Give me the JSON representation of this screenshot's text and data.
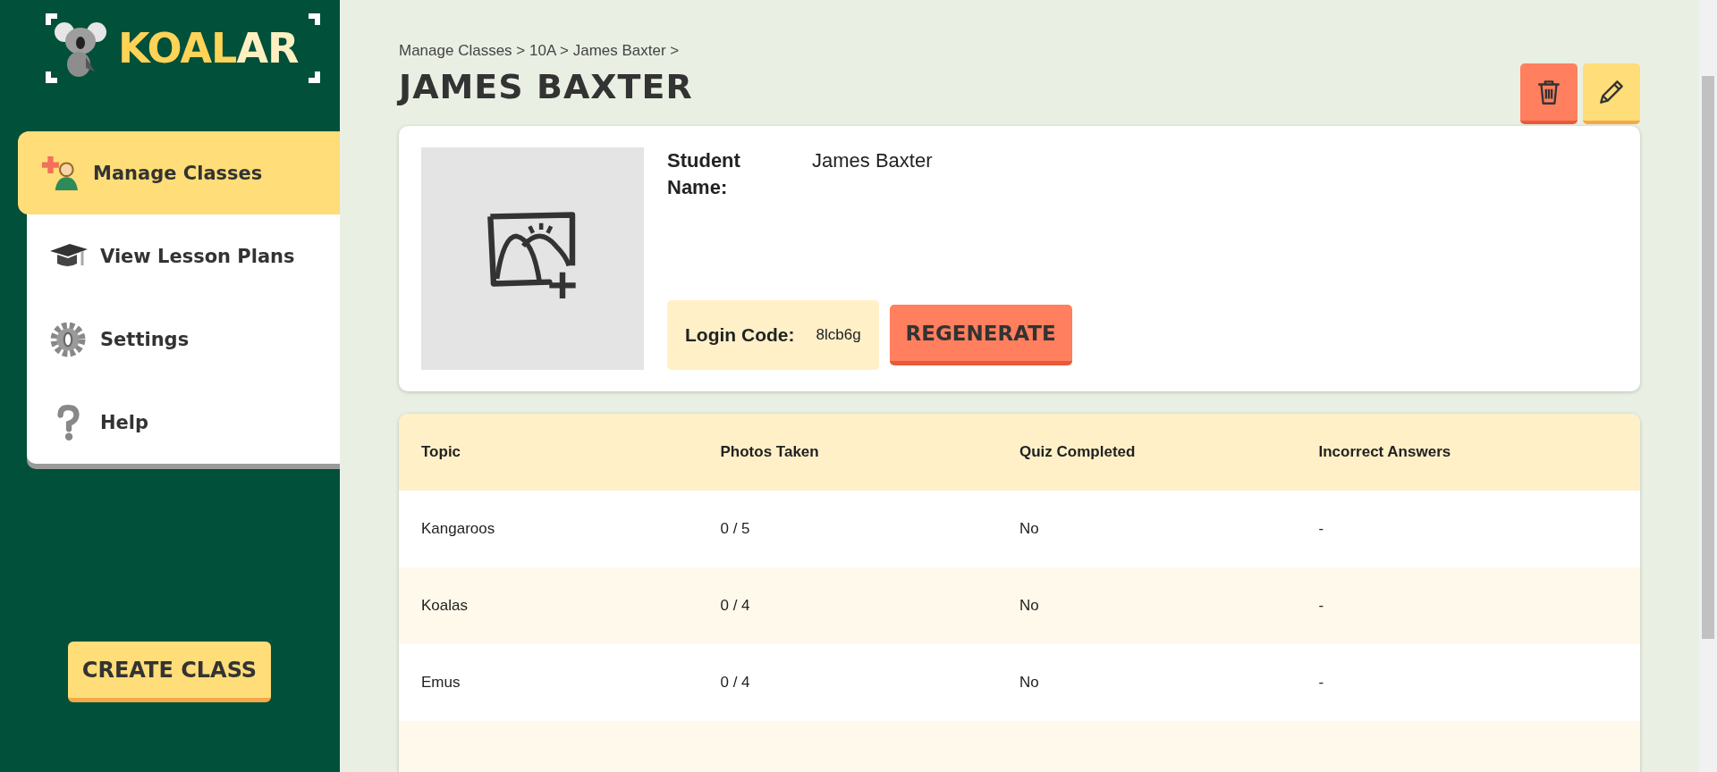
{
  "logo": {
    "text_main": "KOAL",
    "text_accent": "AR"
  },
  "sidebar": {
    "items": [
      {
        "label": "Manage Classes",
        "kind": "classes",
        "selected": true
      },
      {
        "label": "View Lesson Plans",
        "kind": "lessons",
        "selected": false
      },
      {
        "label": "Settings",
        "kind": "settings",
        "selected": false
      },
      {
        "label": "Help",
        "kind": "help",
        "selected": false
      }
    ],
    "create_button": "CREATE CLASS"
  },
  "breadcrumb": "Manage Classes > 10A > James Baxter >",
  "title": "JAMES BAXTER",
  "student": {
    "name_label": "Student Name:",
    "name": "James Baxter",
    "login_label": "Login Code:",
    "login_code": "8lcb6g",
    "regenerate": "REGENERATE"
  },
  "table": {
    "columns": [
      "Topic",
      "Photos Taken",
      "Quiz Completed",
      "Incorrect Answers"
    ],
    "rows": [
      [
        "Kangaroos",
        "0 / 5",
        "No",
        "-"
      ],
      [
        "Koalas",
        "0 / 4",
        "No",
        "-"
      ],
      [
        "Emus",
        "0 / 4",
        "No",
        "-"
      ]
    ]
  }
}
